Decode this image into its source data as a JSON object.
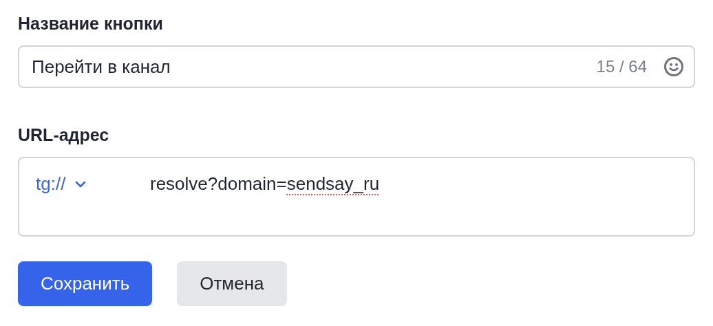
{
  "name_field": {
    "label": "Название кнопки",
    "value": "Перейти в канал",
    "counter": "15 / 64"
  },
  "url_field": {
    "label": "URL-адрес",
    "scheme": "tg://",
    "parts": [
      {
        "text": "resolve?domain=",
        "misspelled": false
      },
      {
        "text": "sendsay_ru",
        "misspelled": true
      }
    ]
  },
  "buttons": [
    {
      "label": "Сохранить",
      "kind": "primary"
    },
    {
      "label": "Отмена",
      "kind": "secondary"
    }
  ]
}
